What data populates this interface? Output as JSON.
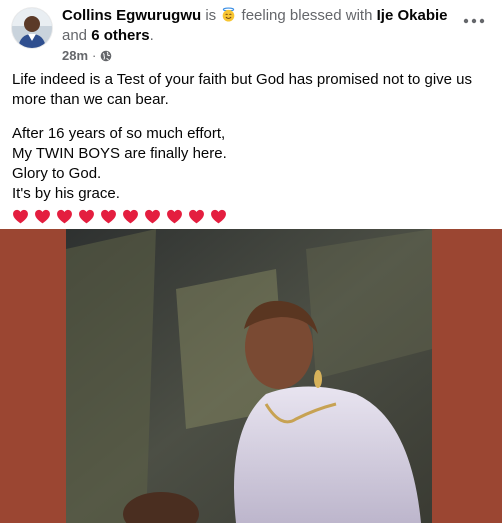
{
  "post": {
    "author": "Collins Egwurugwu",
    "is_text": "is",
    "feeling_text": "feeling blessed with",
    "tagged": "Ije Okabie",
    "and_text": "and",
    "others": "6 others",
    "period": ".",
    "time": "28m",
    "time_sep": "·",
    "paragraph_1": "Life indeed is a Test of your faith but God has promised not to give us more than we can bear.",
    "lines": [
      "After 16 years of so much effort,",
      "My TWIN BOYS are finally here.",
      "Glory to God.",
      "It's by his grace."
    ],
    "hearts_count": 10,
    "heart_color": "#e41e3f"
  },
  "icons": {
    "more": "more-options-icon",
    "privacy": "globe-icon",
    "feeling": "smiling-halo-face-icon",
    "heart": "red-heart-icon"
  },
  "colors": {
    "muted": "#65676b",
    "text": "#050505",
    "photo_background": "#9b4632"
  }
}
